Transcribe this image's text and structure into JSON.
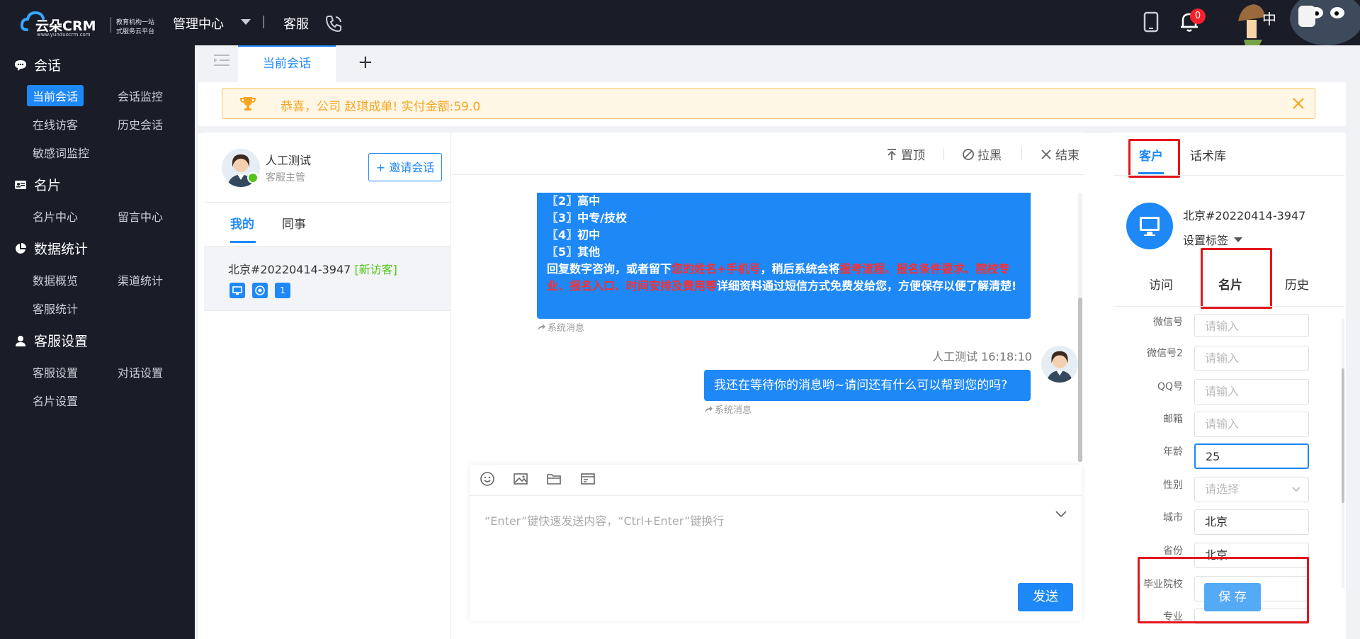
{
  "header": {
    "logo_text": "云朵CRM",
    "logo_url": "www.yunduocrm.com",
    "logo_slogan": "教育机构一站式服务云平台",
    "nav_management": "管理中心",
    "nav_service": "客服",
    "notification_count": "0",
    "avatar_label": "中"
  },
  "sidebar": {
    "sections": [
      {
        "title": "会话",
        "icon": "chat-bubble-icon"
      },
      {
        "title": "名片",
        "icon": "id-card-icon"
      },
      {
        "title": "数据统计",
        "icon": "pie-chart-icon"
      },
      {
        "title": "客服设置",
        "icon": "user-settings-icon"
      }
    ],
    "items": {
      "current_session": "当前会话",
      "session_monitor": "会话监控",
      "online_visitors": "在线访客",
      "history_sessions": "历史会话",
      "sensitive_monitor": "敏感词监控",
      "card_center": "名片中心",
      "message_center": "留言中心",
      "data_overview": "数据概览",
      "channel_stats": "渠道统计",
      "service_stats": "客服统计",
      "service_settings": "客服设置",
      "dialog_settings": "对话设置",
      "card_settings": "名片设置"
    }
  },
  "tabs": {
    "current": "当前会话",
    "add": "+"
  },
  "banner": {
    "text": "恭喜，公司  赵琪成单!    实付金额:59.0"
  },
  "agent": {
    "name": "人工测试",
    "role": "客服主管",
    "invite_label": "+ 邀请会话"
  },
  "session_list": {
    "tab_mine": "我的",
    "tab_colleagues": "同事",
    "visitor_name": "北京#20220414-3947",
    "visitor_tag": "[新访客]",
    "visitor_count": "1"
  },
  "chat_toolbar": {
    "pin": "置顶",
    "block": "拉黑",
    "end": "结束"
  },
  "chat": {
    "sys_lines": [
      "〖2〗高中",
      "〖3〗中专/技校",
      "〖4〗初中",
      "〖5〗其他"
    ],
    "sys_reply_a": "回复数字咨询，或者留下",
    "sys_reply_red1": "您的姓名+手机号",
    "sys_reply_b": "，稍后系统会将",
    "sys_reply_red2": "报考流程、报名条件要求、院校专业、报名入口、时间安排及费用等",
    "sys_reply_c": "详细资料通过短信方式免费发给您，方便保存以便了解清楚!",
    "sys_note": "系统消息",
    "msg_sender": "人工测试",
    "msg_time": "16:18:10",
    "msg_text": "我还在等待你的消息哟~请问还有什么可以帮到您的吗?",
    "msg_note": "系统消息"
  },
  "composer": {
    "placeholder": "“Enter”键快速发送内容，“Ctrl+Enter”键换行",
    "send_label": "发送"
  },
  "right_panel": {
    "tab_customer": "客户",
    "tab_scripts": "话术库",
    "customer_name": "北京#20220414-3947",
    "set_tag": "设置标签",
    "sub_visit": "访问",
    "sub_card": "名片",
    "sub_history": "历史",
    "fields": {
      "wechat_label": "微信号",
      "wechat_placeholder": "请输入",
      "wechat2_label": "微信号2",
      "wechat2_placeholder": "请输入",
      "qq_label": "QQ号",
      "qq_placeholder": "请输入",
      "email_label": "邮箱",
      "email_placeholder": "请输入",
      "age_label": "年龄",
      "age_value": "25",
      "gender_label": "性别",
      "gender_placeholder": "请选择",
      "city_label": "城市",
      "city_value": "北京",
      "province_label": "省份",
      "province_value": "北京",
      "school_label": "毕业院校",
      "major_label": "专业"
    },
    "save_label": "保 存"
  },
  "colors": {
    "primary": "#1e88f7",
    "sidebar_bg": "#1a1c28",
    "highlight_red": "#e4161b",
    "banner_text": "#f5a623"
  }
}
